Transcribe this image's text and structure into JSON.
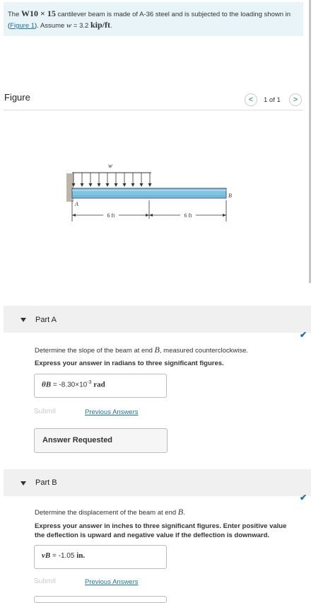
{
  "problem": {
    "text_1": "The",
    "beam_designation": "W10 × 15",
    "text_2": "cantilever beam is made of A-36 steel and is subjected to the loading shown in (",
    "figure_link": "Figure 1",
    "text_3": "). Assume",
    "w_symbol": "w",
    "text_4": "= 3.2",
    "load_unit": "kip/ft",
    "text_5": "."
  },
  "figure": {
    "title": "Figure",
    "nav_prev": "<",
    "nav_next": ">",
    "count": "1 of 1",
    "diagram": {
      "load_label": "w",
      "point_a": "A",
      "point_b": "B",
      "span_1": "6 ft",
      "span_2": "6 ft"
    }
  },
  "part_a": {
    "label": "Part A",
    "question_1": "Determine the slope of the beam at end",
    "question_point": "B",
    "question_2": ", measured counterclockwise.",
    "instruction": "Express your answer in radians to three significant figures.",
    "answer_symbol": "θB",
    "answer_eq": "=",
    "answer_value": "-8.30×10",
    "answer_exp": "-3",
    "answer_unit": "rad",
    "submit": "Submit",
    "previous_answers": "Previous Answers",
    "requested": "Answer Requested"
  },
  "part_b": {
    "label": "Part B",
    "question_1": "Determine the displacement of the beam at end",
    "question_point": "B",
    "question_2": ".",
    "instruction_1": "Express your answer in inches to three significant figures. Enter positive value",
    "instruction_2": "the deflection is upward and negative value if the deflection is downward.",
    "answer_symbol": "vB",
    "answer_eq": "=",
    "answer_value": "-1.05",
    "answer_unit": "in.",
    "submit": "Submit",
    "previous_answers": "Previous Answers"
  },
  "colors": {
    "problem_bg": "#e8f4f8",
    "link": "#1a73a8",
    "check": "#1a6bb5",
    "beam": "#7ec3e0"
  }
}
